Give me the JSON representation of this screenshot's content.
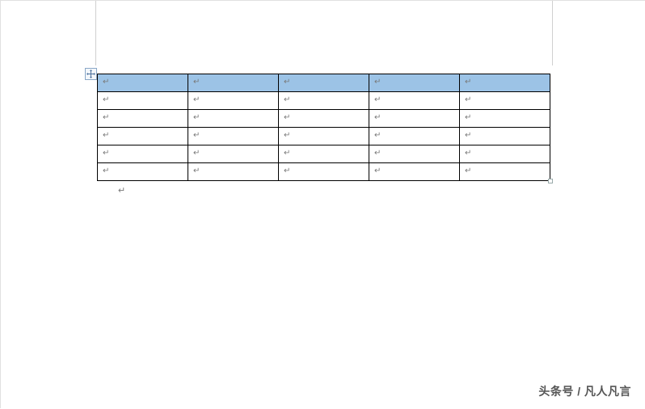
{
  "table": {
    "rows": 6,
    "cols": 5,
    "header_row_index": 0,
    "header_bg": "#9cc3e6",
    "cell_mark": "↵",
    "cells": [
      [
        "↵",
        "↵",
        "↵",
        "↵",
        "↵"
      ],
      [
        "↵",
        "↵",
        "↵",
        "↵",
        "↵"
      ],
      [
        "↵",
        "↵",
        "↵",
        "↵",
        "↵"
      ],
      [
        "↵",
        "↵",
        "↵",
        "↵",
        "↵"
      ],
      [
        "↵",
        "↵",
        "↵",
        "↵",
        "↵"
      ],
      [
        "↵",
        "↵",
        "↵",
        "↵",
        "↵"
      ]
    ]
  },
  "paragraph_mark_after_table": "↵",
  "watermark": "头条号 / 凡人凡言",
  "icons": {
    "table_anchor": "move-icon"
  }
}
